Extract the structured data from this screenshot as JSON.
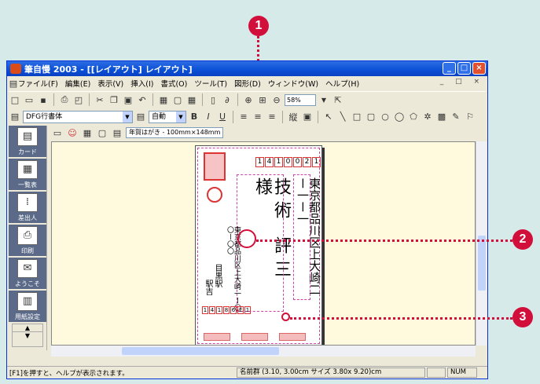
{
  "window": {
    "title": "筆自慢 2003 - [[レイアウト] レイアウト]",
    "controls": [
      "_",
      "□",
      "×"
    ]
  },
  "menu": [
    "ファイル(F)",
    "編集(E)",
    "表示(V)",
    "挿入(I)",
    "書式(O)",
    "ツール(T)",
    "図形(D)",
    "ウィンドウ(W)",
    "ヘルプ(H)"
  ],
  "mdi_controls": "_ □ ×",
  "toolbar1": {
    "zoom": "58%"
  },
  "toolbar2": {
    "font": "DFG行書体",
    "size": "自動"
  },
  "left_panel": [
    "カード",
    "一覧表",
    "差出人",
    "印刷",
    "ようこそ",
    "用紙設定"
  ],
  "docinfo": "年賀はがき - 100mm×148mm",
  "card": {
    "zip_top": [
      "1",
      "4",
      "1",
      "0",
      "0",
      "2",
      "1"
    ],
    "address": "東京都品川区上大崎二ー一ー一",
    "name": "技術 評三 様",
    "sender_address": "東京都品川区上大崎一ー〇〇ー〇〇",
    "sender_name": "目黒駅",
    "sender_name2": "駅吉",
    "zip_bottom": [
      "1",
      "4",
      "1",
      "8",
      "6",
      "2",
      "1"
    ]
  },
  "status": {
    "help": "[F1]を押すと、ヘルプが表示されます。",
    "pos": "名前群 (3.10, 3.00cm サイズ 3.80x 9.20)cm",
    "num": "NUM"
  },
  "callouts": [
    "1",
    "2",
    "3"
  ]
}
